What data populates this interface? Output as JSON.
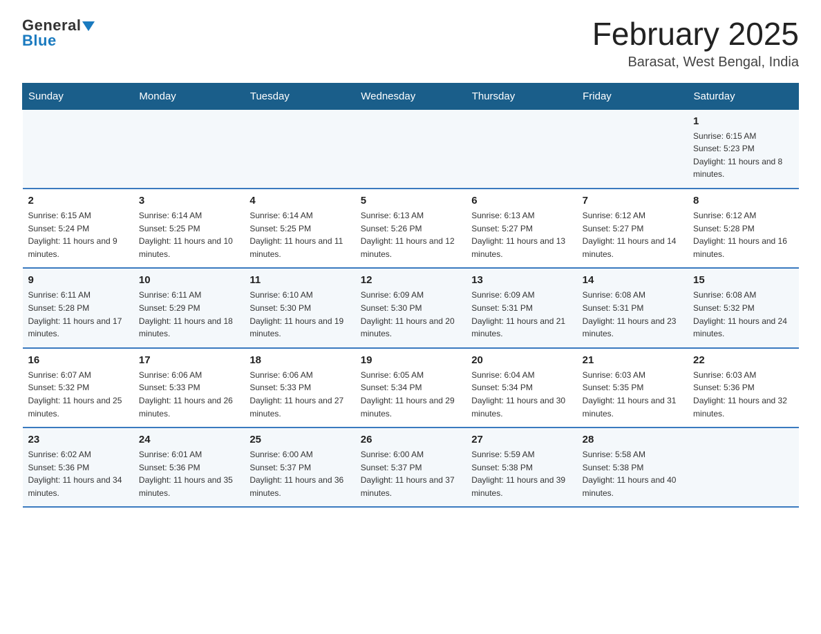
{
  "header": {
    "logo_top": "General",
    "logo_bottom": "Blue",
    "month_title": "February 2025",
    "location": "Barasat, West Bengal, India"
  },
  "weekdays": [
    "Sunday",
    "Monday",
    "Tuesday",
    "Wednesday",
    "Thursday",
    "Friday",
    "Saturday"
  ],
  "weeks": [
    [
      {
        "day": "",
        "info": ""
      },
      {
        "day": "",
        "info": ""
      },
      {
        "day": "",
        "info": ""
      },
      {
        "day": "",
        "info": ""
      },
      {
        "day": "",
        "info": ""
      },
      {
        "day": "",
        "info": ""
      },
      {
        "day": "1",
        "info": "Sunrise: 6:15 AM\nSunset: 5:23 PM\nDaylight: 11 hours and 8 minutes."
      }
    ],
    [
      {
        "day": "2",
        "info": "Sunrise: 6:15 AM\nSunset: 5:24 PM\nDaylight: 11 hours and 9 minutes."
      },
      {
        "day": "3",
        "info": "Sunrise: 6:14 AM\nSunset: 5:25 PM\nDaylight: 11 hours and 10 minutes."
      },
      {
        "day": "4",
        "info": "Sunrise: 6:14 AM\nSunset: 5:25 PM\nDaylight: 11 hours and 11 minutes."
      },
      {
        "day": "5",
        "info": "Sunrise: 6:13 AM\nSunset: 5:26 PM\nDaylight: 11 hours and 12 minutes."
      },
      {
        "day": "6",
        "info": "Sunrise: 6:13 AM\nSunset: 5:27 PM\nDaylight: 11 hours and 13 minutes."
      },
      {
        "day": "7",
        "info": "Sunrise: 6:12 AM\nSunset: 5:27 PM\nDaylight: 11 hours and 14 minutes."
      },
      {
        "day": "8",
        "info": "Sunrise: 6:12 AM\nSunset: 5:28 PM\nDaylight: 11 hours and 16 minutes."
      }
    ],
    [
      {
        "day": "9",
        "info": "Sunrise: 6:11 AM\nSunset: 5:28 PM\nDaylight: 11 hours and 17 minutes."
      },
      {
        "day": "10",
        "info": "Sunrise: 6:11 AM\nSunset: 5:29 PM\nDaylight: 11 hours and 18 minutes."
      },
      {
        "day": "11",
        "info": "Sunrise: 6:10 AM\nSunset: 5:30 PM\nDaylight: 11 hours and 19 minutes."
      },
      {
        "day": "12",
        "info": "Sunrise: 6:09 AM\nSunset: 5:30 PM\nDaylight: 11 hours and 20 minutes."
      },
      {
        "day": "13",
        "info": "Sunrise: 6:09 AM\nSunset: 5:31 PM\nDaylight: 11 hours and 21 minutes."
      },
      {
        "day": "14",
        "info": "Sunrise: 6:08 AM\nSunset: 5:31 PM\nDaylight: 11 hours and 23 minutes."
      },
      {
        "day": "15",
        "info": "Sunrise: 6:08 AM\nSunset: 5:32 PM\nDaylight: 11 hours and 24 minutes."
      }
    ],
    [
      {
        "day": "16",
        "info": "Sunrise: 6:07 AM\nSunset: 5:32 PM\nDaylight: 11 hours and 25 minutes."
      },
      {
        "day": "17",
        "info": "Sunrise: 6:06 AM\nSunset: 5:33 PM\nDaylight: 11 hours and 26 minutes."
      },
      {
        "day": "18",
        "info": "Sunrise: 6:06 AM\nSunset: 5:33 PM\nDaylight: 11 hours and 27 minutes."
      },
      {
        "day": "19",
        "info": "Sunrise: 6:05 AM\nSunset: 5:34 PM\nDaylight: 11 hours and 29 minutes."
      },
      {
        "day": "20",
        "info": "Sunrise: 6:04 AM\nSunset: 5:34 PM\nDaylight: 11 hours and 30 minutes."
      },
      {
        "day": "21",
        "info": "Sunrise: 6:03 AM\nSunset: 5:35 PM\nDaylight: 11 hours and 31 minutes."
      },
      {
        "day": "22",
        "info": "Sunrise: 6:03 AM\nSunset: 5:36 PM\nDaylight: 11 hours and 32 minutes."
      }
    ],
    [
      {
        "day": "23",
        "info": "Sunrise: 6:02 AM\nSunset: 5:36 PM\nDaylight: 11 hours and 34 minutes."
      },
      {
        "day": "24",
        "info": "Sunrise: 6:01 AM\nSunset: 5:36 PM\nDaylight: 11 hours and 35 minutes."
      },
      {
        "day": "25",
        "info": "Sunrise: 6:00 AM\nSunset: 5:37 PM\nDaylight: 11 hours and 36 minutes."
      },
      {
        "day": "26",
        "info": "Sunrise: 6:00 AM\nSunset: 5:37 PM\nDaylight: 11 hours and 37 minutes."
      },
      {
        "day": "27",
        "info": "Sunrise: 5:59 AM\nSunset: 5:38 PM\nDaylight: 11 hours and 39 minutes."
      },
      {
        "day": "28",
        "info": "Sunrise: 5:58 AM\nSunset: 5:38 PM\nDaylight: 11 hours and 40 minutes."
      },
      {
        "day": "",
        "info": ""
      }
    ]
  ]
}
